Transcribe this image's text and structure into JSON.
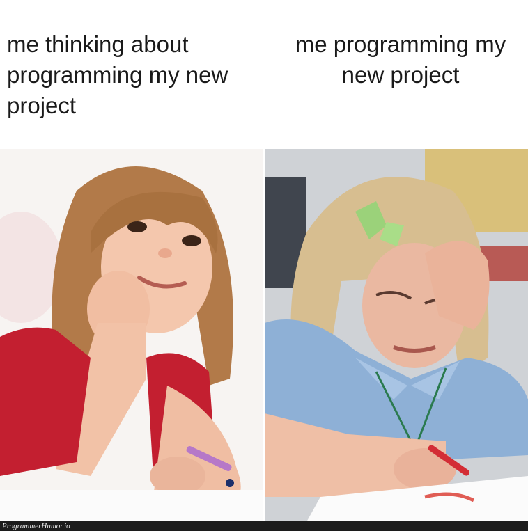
{
  "meme": {
    "left_caption": "me thinking about programming my new project",
    "right_caption": "me programming my new project",
    "left_image": "happy-daydreaming-girl",
    "right_image": "crying-girl-drawing"
  },
  "footer": {
    "watermark": "ProgrammerHumor.io"
  }
}
